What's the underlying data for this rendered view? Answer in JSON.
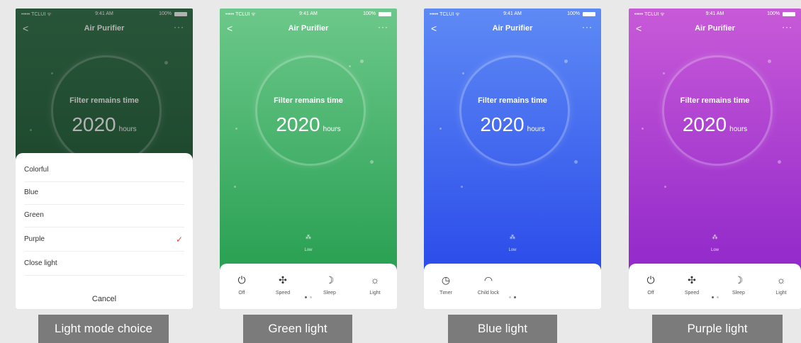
{
  "status": {
    "carrier": "••••• TCLUI ᯤ",
    "time": "9:41 AM",
    "battery": "100%"
  },
  "app": {
    "title": "Air Purifier",
    "back": "<",
    "more": "···"
  },
  "filter": {
    "label": "Filter remains time",
    "value": "2020",
    "unit": "hours"
  },
  "fan": {
    "icon": "fan-speed-icon",
    "level": "Low"
  },
  "controls_main": [
    {
      "label": "Off",
      "icon": "power-icon",
      "glyph": "⏻"
    },
    {
      "label": "Speed",
      "icon": "fan-icon",
      "glyph": "✣"
    },
    {
      "label": "Sleep",
      "icon": "moon-icon",
      "glyph": "☽"
    },
    {
      "label": "Light",
      "icon": "lightbulb-icon",
      "glyph": "☼"
    }
  ],
  "controls_page2": [
    {
      "label": "Timer",
      "icon": "clock-icon",
      "glyph": "◷"
    },
    {
      "label": "Child lock",
      "icon": "child-lock-icon",
      "glyph": "◠"
    }
  ],
  "light_menu": {
    "options": [
      "Colorful",
      "Blue",
      "Green",
      "Purple",
      "Close light"
    ],
    "selected": "Purple",
    "cancel": "Cancel"
  },
  "captions": [
    "Light mode choice",
    "Green light",
    "Blue light",
    "Purple light"
  ],
  "colors": {
    "dark_green": "#1f5a36",
    "green": "#1f9a4a",
    "blue": "#2443e8",
    "purple": "#8a22c8",
    "check": "#e64a4a"
  }
}
